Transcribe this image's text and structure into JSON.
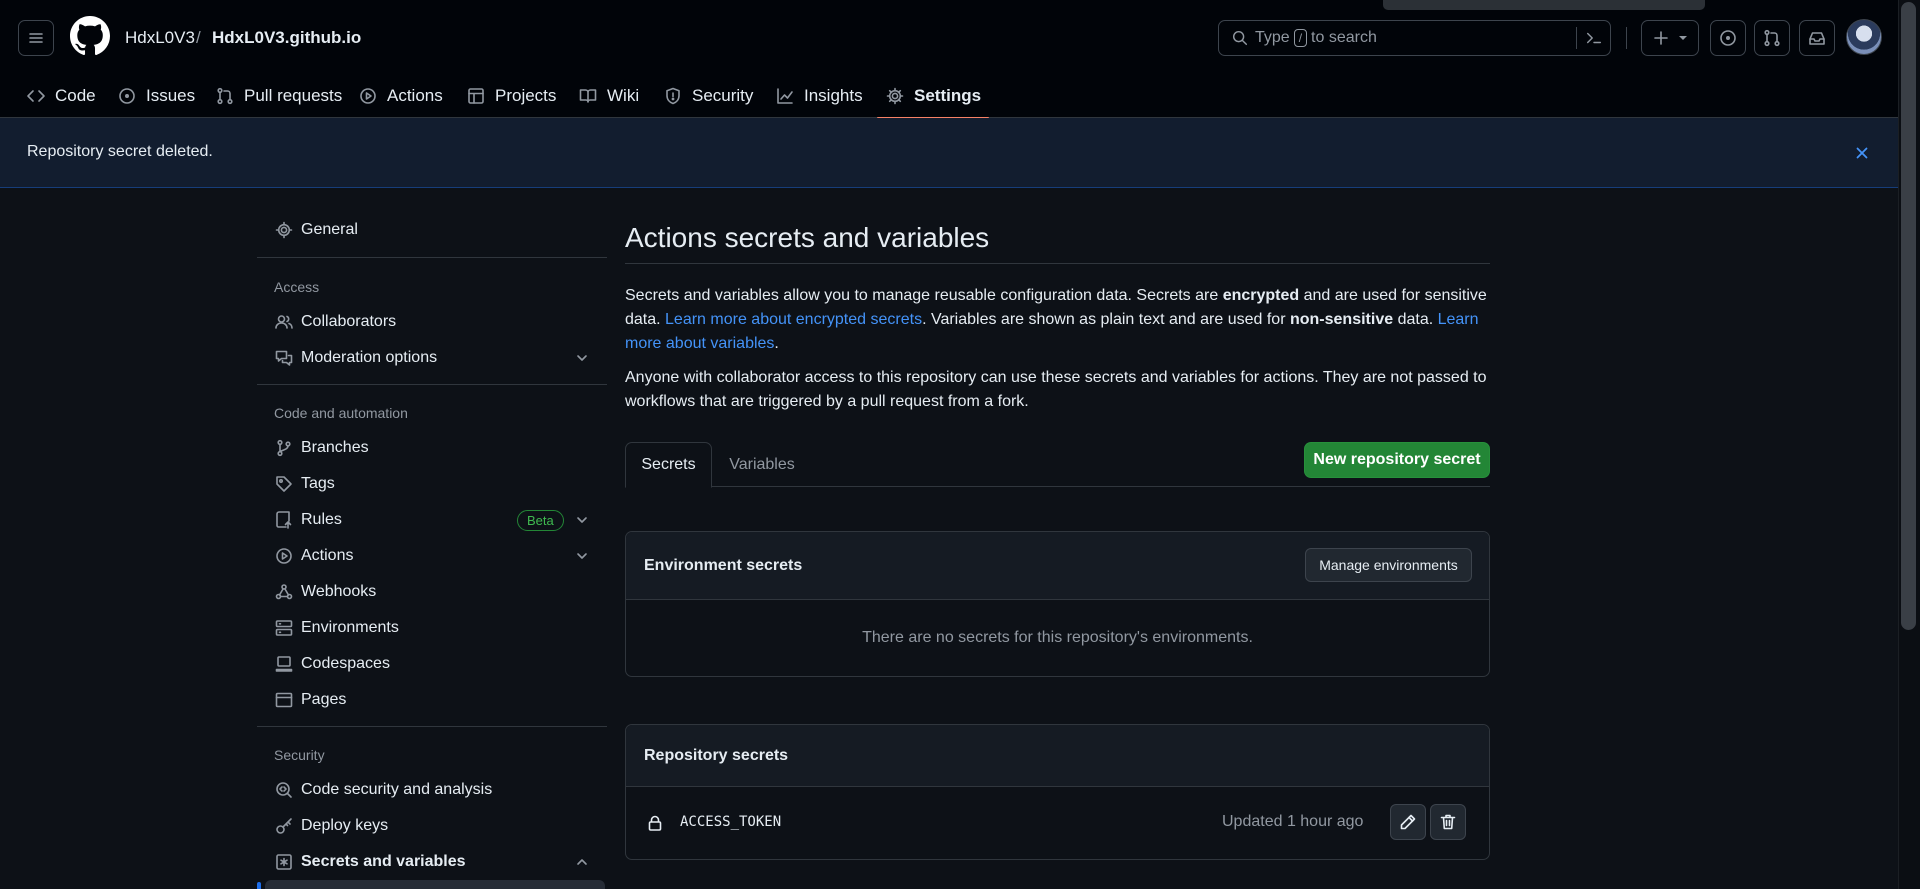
{
  "header": {
    "owner": "HdxL0V3",
    "separator": "/",
    "repo": "HdxL0V3.github.io",
    "search_placeholder_pre": "Type",
    "search_key": "/",
    "search_placeholder_post": "to search"
  },
  "repo_nav": [
    {
      "label": "Code",
      "icon": "code-icon"
    },
    {
      "label": "Issues",
      "icon": "issue-icon"
    },
    {
      "label": "Pull requests",
      "icon": "pull-request-icon"
    },
    {
      "label": "Actions",
      "icon": "play-icon"
    },
    {
      "label": "Projects",
      "icon": "table-icon"
    },
    {
      "label": "Wiki",
      "icon": "book-icon"
    },
    {
      "label": "Security",
      "icon": "shield-icon"
    },
    {
      "label": "Insights",
      "icon": "graph-icon"
    },
    {
      "label": "Settings",
      "icon": "gear-icon",
      "active": true
    }
  ],
  "flash": {
    "message": "Repository secret deleted."
  },
  "sidebar": {
    "general": "General",
    "access_heading": "Access",
    "collaborators": "Collaborators",
    "moderation": "Moderation options",
    "code_heading": "Code and automation",
    "branches": "Branches",
    "tags": "Tags",
    "rules": "Rules",
    "beta": "Beta",
    "actions": "Actions",
    "webhooks": "Webhooks",
    "environments": "Environments",
    "codespaces": "Codespaces",
    "pages": "Pages",
    "security_heading": "Security",
    "code_security": "Code security and analysis",
    "deploy_keys": "Deploy keys",
    "secrets": "Secrets and variables"
  },
  "main": {
    "title": "Actions secrets and variables",
    "p1_a": "Secrets and variables allow you to manage reusable configuration data. Secrets are ",
    "p1_b": "encrypted",
    "p1_c": " and are used for sensitive data. ",
    "p1_link1": "Learn more about encrypted secrets",
    "p1_d": ". Variables are shown as plain text and are used for ",
    "p1_e": "non-sensitive",
    "p1_f": " data. ",
    "p1_link2": "Learn more about variables",
    "p1_g": ".",
    "p2": "Anyone with collaborator access to this repository can use these secrets and variables for actions. They are not passed to workflows that are triggered by a pull request from a fork.",
    "tab_secrets": "Secrets",
    "tab_variables": "Variables",
    "new_secret_button": "New repository secret",
    "env_title": "Environment secrets",
    "manage_env_button": "Manage environments",
    "env_empty": "There are no secrets for this repository's environments.",
    "repo_title": "Repository secrets",
    "secrets": [
      {
        "name": "ACCESS_TOKEN",
        "updated": "Updated 1 hour ago"
      }
    ]
  },
  "colors": {
    "bg": "#0d1117",
    "header_bg": "#010409",
    "accent_link": "#4493f8",
    "primary_button": "#238636",
    "active_tab_underline": "#f78166"
  }
}
